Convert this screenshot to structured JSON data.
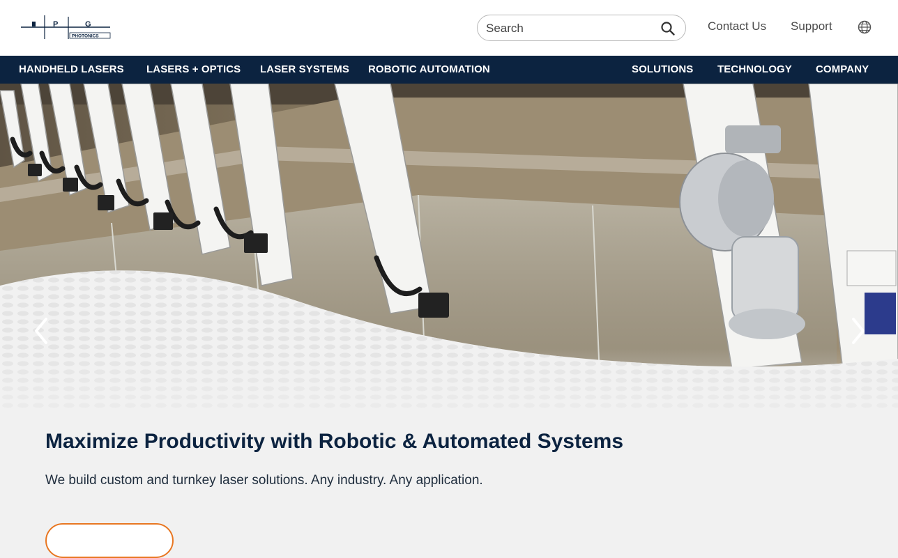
{
  "header": {
    "logo_text": "IPG PHOTONICS",
    "search": {
      "placeholder": "Search"
    },
    "links": {
      "contact": "Contact Us",
      "support": "Support"
    }
  },
  "nav": {
    "left": [
      "HANDHELD LASERS",
      "LASERS + OPTICS",
      "LASER SYSTEMS",
      "ROBOTIC AUTOMATION"
    ],
    "right": [
      "SOLUTIONS",
      "TECHNOLOGY",
      "COMPANY"
    ]
  },
  "hero": {
    "headline": "Maximize Productivity with Robotic & Automated Systems",
    "subtext": "We build custom and turnkey laser solutions. Any industry. Any application.",
    "cta_label": ""
  },
  "colors": {
    "navy": "#0c2340",
    "accent": "#e87722",
    "page_bg": "#f1f1f1"
  },
  "icons": [
    "search-icon",
    "globe-icon",
    "chevron-left-icon",
    "chevron-right-icon"
  ]
}
